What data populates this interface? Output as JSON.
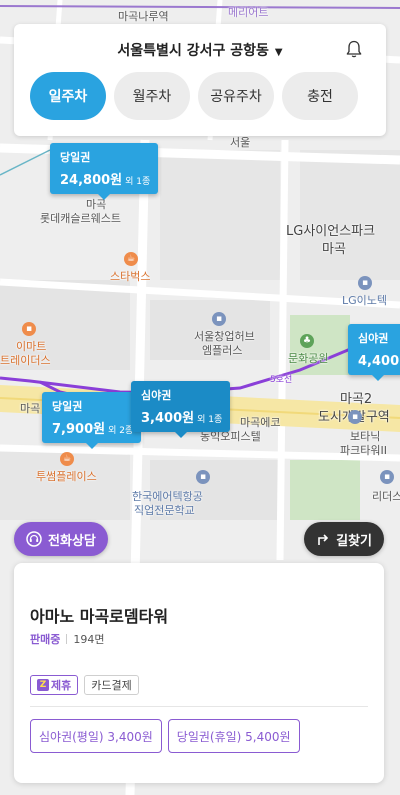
{
  "header": {
    "location": "서울특별시 강서구 공항동",
    "tabs": [
      {
        "label": "일주차",
        "active": true
      },
      {
        "label": "월주차",
        "active": false
      },
      {
        "label": "공유주차",
        "active": false
      },
      {
        "label": "충전",
        "active": false
      }
    ]
  },
  "map": {
    "labels": {
      "top_road": "마곡나루역",
      "metro_top": "메리어트",
      "magok1": "마곡",
      "lotte_castle": "롯데캐슬르웨스트",
      "lg_science_park": "LG사이언스파크",
      "lg_science_sub": "마곡",
      "lg_innotek": "LG이노텍",
      "starbucks": "스타벅스",
      "emart": "이마트",
      "emart2": "트레이더스",
      "seoul_startup": "서울창업허브",
      "seoul_startup2": "엠플러스",
      "munhwa_park": "문화공원",
      "magok2": "마곡2",
      "magok2_sub": "도시개발구역",
      "magok_left": "마곡",
      "line5": "5호선",
      "eco_office": "마곡에코",
      "eco_office2": "동익오피스텔",
      "botanic": "보타닉",
      "botanic2": "파크타워II",
      "twosome": "투썸플레이스",
      "aviation": "한국에어텍항공",
      "aviation2": "직업전문학교",
      "ritz": "리더스",
      "seoul_top": "서울"
    },
    "markers": [
      {
        "type": "당일권",
        "price": "24,800원",
        "count": "외 1종"
      },
      {
        "type": "심야권",
        "price": "4,400",
        "count": ""
      },
      {
        "type": "당일권",
        "price": "7,900원",
        "count": "외 2종"
      },
      {
        "type": "심야권",
        "price": "3,400원",
        "count": "외 1종"
      }
    ]
  },
  "buttons": {
    "phone": "전화상담",
    "route": "길찾기"
  },
  "card": {
    "name": "아마노 마곡로뎀타워",
    "status": "판매중",
    "spaces": "194면",
    "tags": {
      "partner": "제휴",
      "partner_badge": "Z",
      "card_payment": "카드결제"
    },
    "products": [
      "심야권(평일) 3,400원",
      "당일권(휴일) 5,400원"
    ]
  },
  "colors": {
    "primary": "#2aa3e0",
    "purple": "#8a5bd2",
    "dark": "#333333"
  }
}
